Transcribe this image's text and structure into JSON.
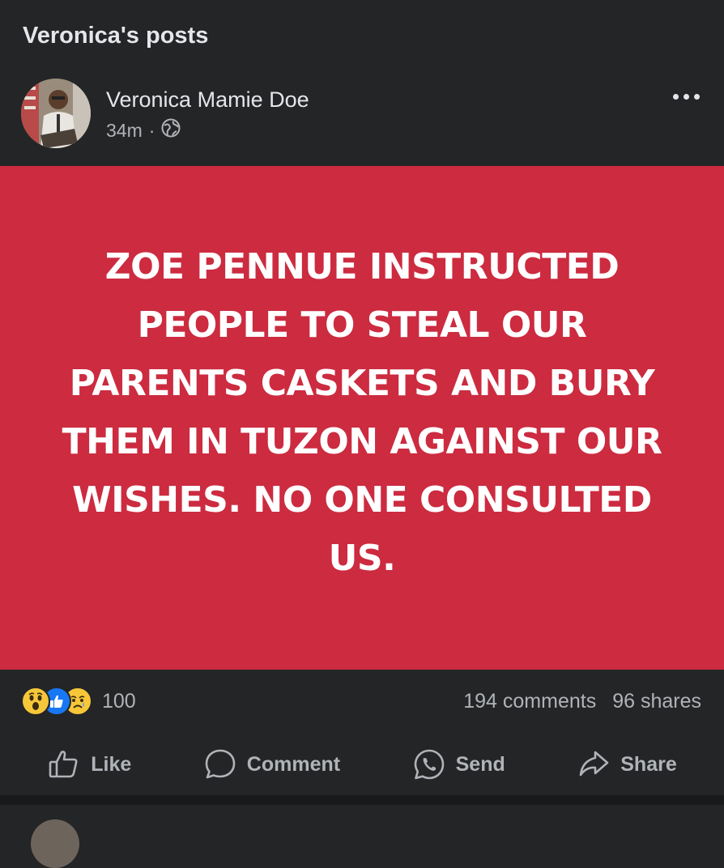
{
  "header": {
    "title": "Veronica's posts"
  },
  "post": {
    "author": "Veronica Mamie Doe",
    "time": "34m",
    "separator": "·",
    "privacy_icon": "globe-icon",
    "more_icon": "more-options-icon",
    "text": "ZOE PENNUE  INSTRUCTED PEOPLE TO STEAL OUR PARENTS CASKETS AND BURY THEM IN TUZON AGAINST OUR WISHES. NO ONE CONSULTED US.",
    "background_color": "#cc2b40"
  },
  "stats": {
    "reaction_icons": [
      "wow-reaction-icon",
      "like-reaction-icon",
      "sad-reaction-icon"
    ],
    "reaction_count": "100",
    "comments": "194 comments",
    "shares": "96 shares"
  },
  "actions": {
    "like": "Like",
    "comment": "Comment",
    "send": "Send",
    "share": "Share"
  },
  "colors": {
    "surface": "#242526",
    "text_primary": "#e4e6eb",
    "text_secondary": "#b0b3b8",
    "like_blue": "#1877f2",
    "reaction_yellow": "#f7c73a"
  }
}
